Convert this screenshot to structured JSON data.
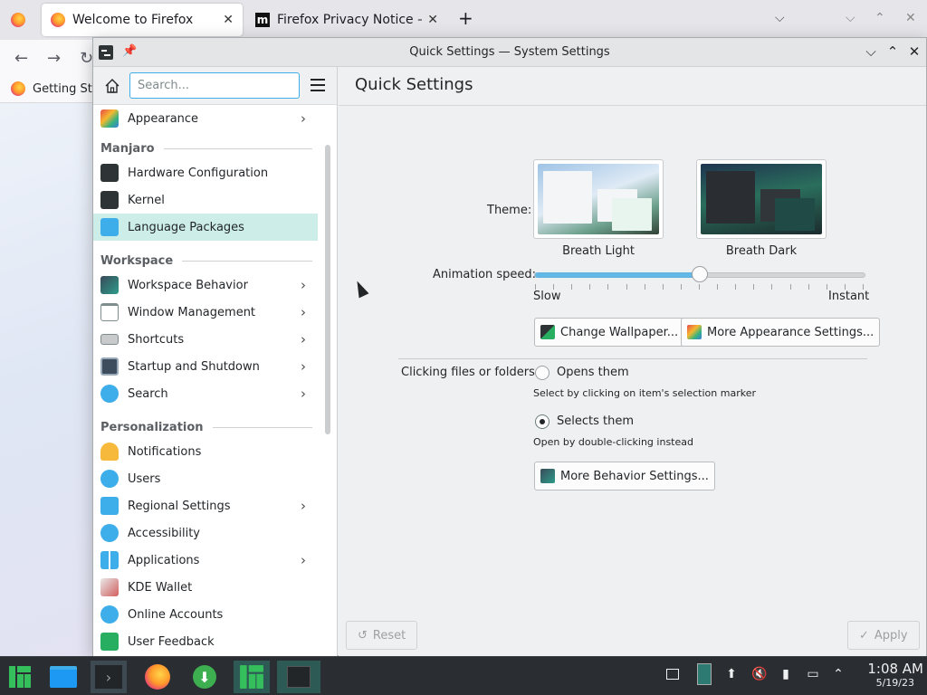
{
  "firefox": {
    "tabs": [
      {
        "label": "Welcome to Firefox"
      },
      {
        "label": "Firefox Privacy Notice — M"
      }
    ],
    "new_tab": "+",
    "bookmark": "Getting Sta"
  },
  "window": {
    "title": "Quick Settings — System Settings"
  },
  "sidebar": {
    "search_placeholder": "Search...",
    "items": [
      {
        "label": "Appearance"
      },
      {
        "label": "Hardware Configuration"
      },
      {
        "label": "Kernel"
      },
      {
        "label": "Language Packages"
      },
      {
        "label": "Workspace Behavior"
      },
      {
        "label": "Window Management"
      },
      {
        "label": "Shortcuts"
      },
      {
        "label": "Startup and Shutdown"
      },
      {
        "label": "Search"
      },
      {
        "label": "Notifications"
      },
      {
        "label": "Users"
      },
      {
        "label": "Regional Settings"
      },
      {
        "label": "Accessibility"
      },
      {
        "label": "Applications"
      },
      {
        "label": "KDE Wallet"
      },
      {
        "label": "Online Accounts"
      },
      {
        "label": "User Feedback"
      }
    ],
    "sections": {
      "manjaro": "Manjaro",
      "workspace": "Workspace",
      "personalization": "Personalization"
    }
  },
  "main": {
    "page_title": "Quick Settings",
    "theme_label": "Theme:",
    "themes": [
      {
        "name": "Breath Light"
      },
      {
        "name": "Breath Dark"
      }
    ],
    "animation_label": "Animation speed:",
    "animation_speed": 0.5,
    "slider_min_label": "Slow",
    "slider_max_label": "Instant",
    "change_wallpaper": "Change Wallpaper...",
    "more_appearance": "More Appearance Settings...",
    "clicking_label": "Clicking files or folders:",
    "opens_them": "Opens them",
    "opens_hint": "Select by clicking on item's selection marker",
    "selects_them": "Selects them",
    "selects_hint": "Open by double-clicking instead",
    "more_behavior": "More Behavior Settings...",
    "reset": "Reset",
    "apply": "Apply"
  },
  "taskbar": {
    "time": "1:08 AM",
    "date": "5/19/23"
  },
  "colors": {
    "accent": "#3daee9",
    "selection": "#cdeee8",
    "taskbar": "#2a2e32"
  }
}
